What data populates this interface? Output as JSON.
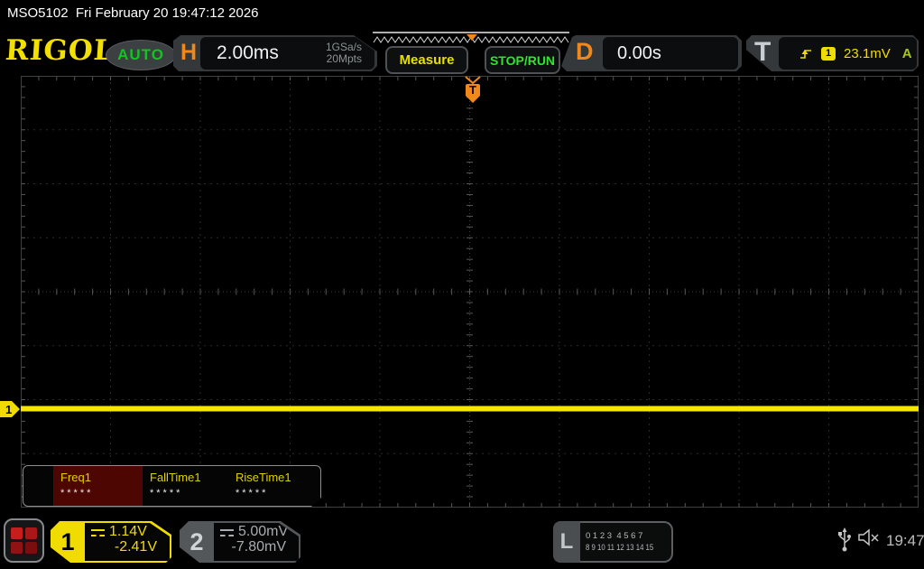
{
  "statusbar": {
    "model": "MSO5102",
    "datetime": "Fri February 20 19:47:12 2026"
  },
  "header": {
    "logo": "RIGOL",
    "auto_label": "AUTO",
    "horizontal": {
      "label": "H",
      "timebase": "2.00ms",
      "sample_rate": "1GSa/s",
      "mem_depth": "20Mpts"
    },
    "measure_label": "Measure",
    "stoprun_label": "STOP/RUN",
    "delay": {
      "label": "D",
      "value": "0.00s"
    },
    "trigger": {
      "label": "T",
      "slope_icon": "rising-edge-icon",
      "source_channel": "1",
      "level": "23.1mV",
      "mode": "A"
    }
  },
  "graticule": {
    "trigger_marker": "T",
    "h_divisions": 10,
    "v_divisions": 8
  },
  "trace": {
    "channel": "1",
    "description": "flat horizontal line",
    "color": "#f6e600"
  },
  "measurements": {
    "items": [
      {
        "label": "Freq1",
        "value": "*****",
        "selected": true
      },
      {
        "label": "FallTime1",
        "value": "*****",
        "selected": false
      },
      {
        "label": "RiseTime1",
        "value": "*****",
        "selected": false
      }
    ]
  },
  "bottombar": {
    "ch1": {
      "number": "1",
      "coupling_icon": "dc-coupling-icon",
      "scale": "1.14V",
      "offset": "-2.41V"
    },
    "ch2": {
      "number": "2",
      "coupling_icon": "dc-coupling-icon",
      "scale": "5.00mV",
      "offset": "-7.80mV"
    },
    "logic": {
      "label": "L",
      "row1": "0 1 2 3  4 5 6 7",
      "row2": "8 9 10 11 12 13 14 15"
    },
    "time": "19:47"
  },
  "colors": {
    "ch1_yellow": "#f0dc00",
    "ch2_gray": "#a8acae",
    "trigger_orange": "#f0881c",
    "run_green": "#2ee62e",
    "auto_green": "#12c422",
    "measure_yellow": "#e8e000",
    "selected_measurement_bg": "#4e0602"
  }
}
